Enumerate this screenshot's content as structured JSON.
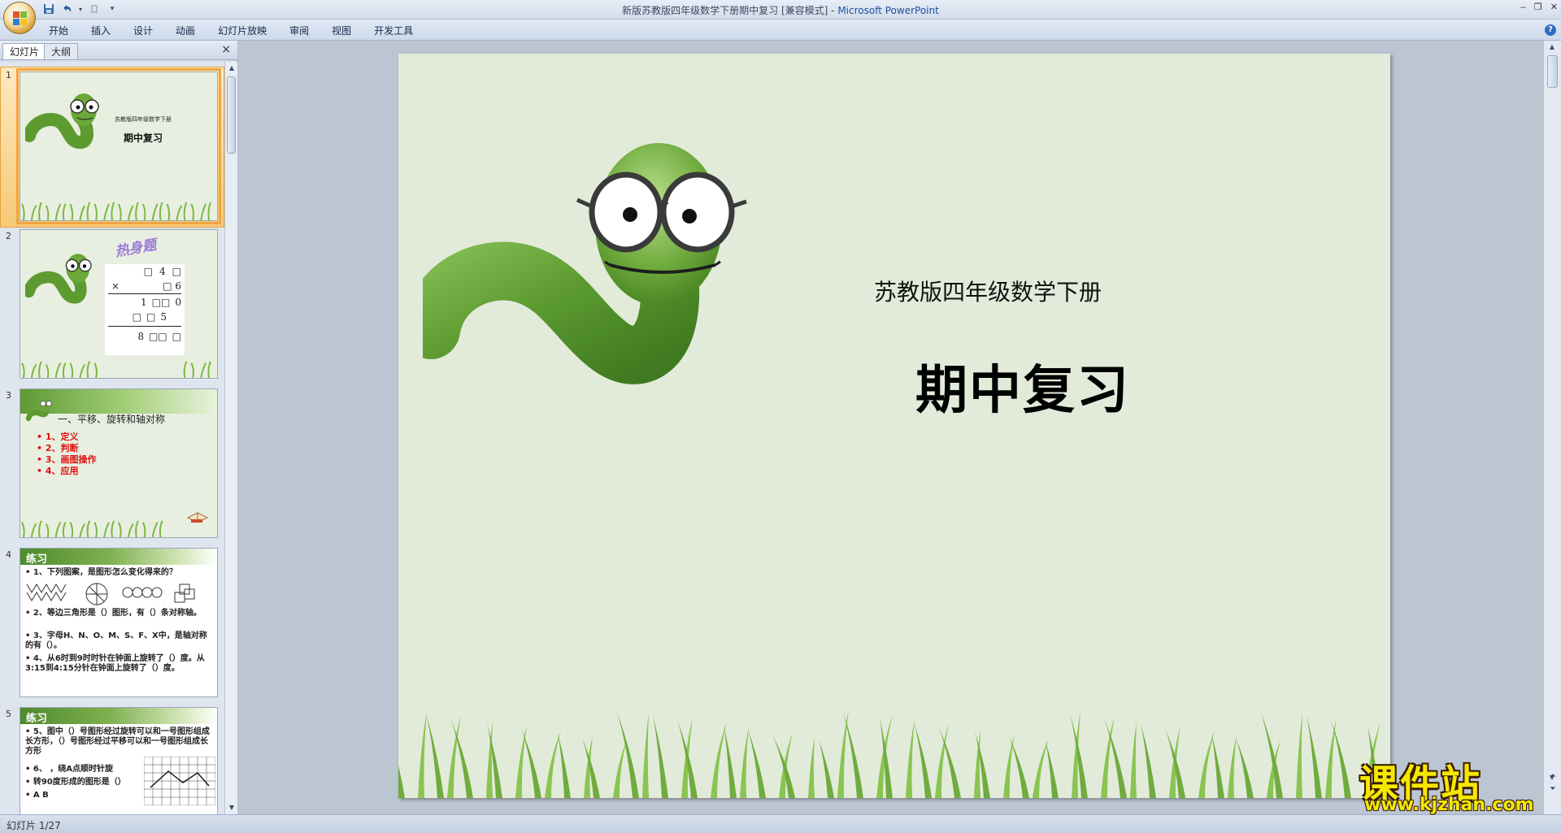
{
  "window": {
    "title": "新版苏教版四年级数学下册期中复习 [兼容模式]",
    "title_sep": " - ",
    "app_name": "Microsoft PowerPoint"
  },
  "quick_access": {
    "save_icon": "save-icon",
    "undo_icon": "undo-icon",
    "redo_icon": "redo-icon",
    "customize_icon": "customize-qat-icon"
  },
  "ribbon": {
    "tabs": [
      "开始",
      "插入",
      "设计",
      "动画",
      "幻灯片放映",
      "审阅",
      "视图",
      "开发工具"
    ]
  },
  "left_panel": {
    "tabs": {
      "slides": "幻灯片",
      "outline": "大纲"
    },
    "close": "×"
  },
  "thumbnails": [
    {
      "num": "1",
      "subtitle": "苏教版四年级数学下册",
      "title": "期中复习"
    },
    {
      "num": "2",
      "heading": "热身题",
      "rows": [
        [
          "",
          "□",
          "4",
          "□"
        ],
        [
          "×",
          "",
          "□",
          "6"
        ],
        [
          "",
          "1",
          "□□",
          "0"
        ],
        [
          "",
          "□",
          "□",
          "5"
        ],
        [
          "",
          "8",
          "□□",
          "□"
        ]
      ]
    },
    {
      "num": "3",
      "heading": "一、平移、旋转和轴对称",
      "items": [
        "• 1、定义",
        "• 2、判断",
        "• 3、画图操作",
        "• 4、应用"
      ]
    },
    {
      "num": "4",
      "header": "练习",
      "lines": [
        "• 1、下列图案，是图形怎么变化得来的？",
        "• 2、等边三角形是（）图形，有（）条对称轴。",
        "• 3、字母H、N、O、M、S、F、X中，是轴对称的有（）。",
        "• 4、从6时到9时时针在钟面上旋转了（）度。从3:15到4:15分针在钟面上旋转了（）度。"
      ]
    },
    {
      "num": "5",
      "header": "练习",
      "lines": [
        "• 5、图中（）号图形经过旋转可以和一号图形组成长方形，（）号图形经过平移可以和一号图形组成长方形",
        "• 6、     ，绕A点顺时针旋",
        "• 转90度形成的图形是（）",
        "• A          B"
      ]
    }
  ],
  "slide": {
    "subtitle": "苏教版四年级数学下册",
    "title": "期中复习"
  },
  "status": {
    "slide_counter": "幻灯片 1/27"
  },
  "watermark": {
    "brand": "课件站",
    "url": "www.kjzhan.com"
  },
  "colors": {
    "accent": "#f0a441",
    "slide_bg": "#e2ebda",
    "grass": "#7ab83e",
    "worm": "#6aa83a"
  }
}
